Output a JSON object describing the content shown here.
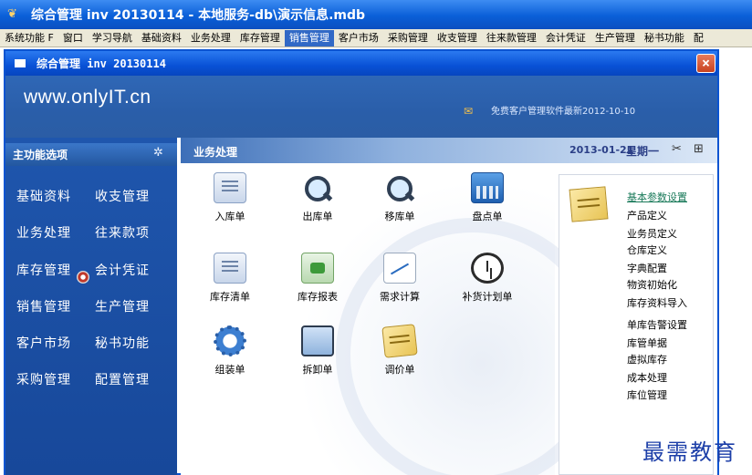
{
  "outer_window": {
    "title": "综合管理 inv 20130114 - 本地服务-db\\演示信息.mdb"
  },
  "menubar": {
    "items": [
      "系统功能 F",
      "窗口",
      "学习导航",
      "基础资料",
      "业务处理",
      "库存管理",
      "销售管理",
      "客户市场",
      "采购管理",
      "收支管理",
      "往来款管理",
      "会计凭证",
      "生产管理",
      "秘书功能",
      "配"
    ],
    "active": "销售管理"
  },
  "inner_window": {
    "title": "综合管理 inv 20130114",
    "close_label": "×"
  },
  "banner": {
    "site": "www.onlyIT.cn",
    "news": "免费客户管理软件最新2012-10-10"
  },
  "sidebar": {
    "header": "主功能选项",
    "items": [
      "基础资料",
      "收支管理",
      "业务处理",
      "往来款项",
      "库存管理",
      "会计凭证",
      "销售管理",
      "生产管理",
      "客户市场",
      "秘书功能",
      "采购管理",
      "配置管理"
    ]
  },
  "content": {
    "title": "业务处理",
    "date": "2013-01-21",
    "weekday": "星期一",
    "tiles": [
      {
        "label": "入库单",
        "icon": "doc-icon"
      },
      {
        "label": "出库单",
        "icon": "magnifier-icon"
      },
      {
        "label": "移库单",
        "icon": "magnifier-icon"
      },
      {
        "label": "盘点单",
        "icon": "calculator-icon"
      },
      {
        "label": "库存清单",
        "icon": "list-icon"
      },
      {
        "label": "库存报表",
        "icon": "report-icon"
      },
      {
        "label": "需求计算",
        "icon": "chart-icon"
      },
      {
        "label": "补货计划单",
        "icon": "clock-icon"
      },
      {
        "label": "组装单",
        "icon": "gear-icon"
      },
      {
        "label": "拆卸单",
        "icon": "screen-icon"
      },
      {
        "label": "调价单",
        "icon": "note-icon"
      }
    ]
  },
  "right_panel": {
    "links": [
      "基本参数设置",
      "产品定义",
      "业务员定义",
      "仓库定义",
      "字典配置",
      "物资初始化",
      "库存资料导入",
      "单库告警设置",
      "库管单据",
      "虚拟库存",
      "成本处理",
      "库位管理"
    ]
  },
  "watermark": "最需教育"
}
